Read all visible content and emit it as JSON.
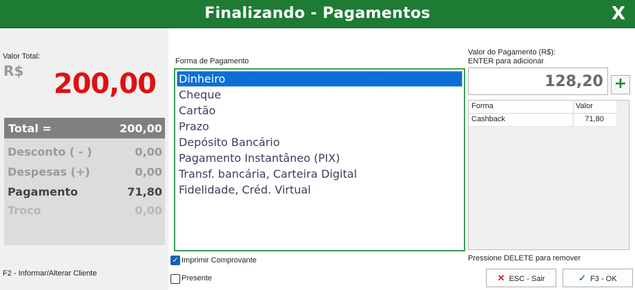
{
  "window": {
    "title": "Finalizando - Pagamentos",
    "close_label": "X"
  },
  "summary": {
    "valor_total_label": "Valor Total:",
    "currency": "R$",
    "valor_total": "200,00",
    "total_label": "Total =",
    "total_value": "200,00",
    "desconto_label": "Desconto ( - )",
    "desconto_value": "0,00",
    "despesas_label": "Despesas (+)",
    "despesas_value": "0,00",
    "pagamento_label": "Pagamento",
    "pagamento_value": "71,80",
    "troco_label": "Troco",
    "troco_value": "0,00"
  },
  "f2_hint": "F2 - Informar/Alterar Cliente",
  "forma": {
    "label": "Forma de Pagamento",
    "items": [
      "Dinheiro",
      "Cheque",
      "Cartão",
      "Prazo",
      "Depósito Bancário",
      "Pagamento Instantâneo (PIX)",
      "Transf. bancária, Carteira Digital",
      "Fidelidade, Créd. Virtual"
    ],
    "selected": "Dinheiro"
  },
  "options": {
    "imprimir_label": "Imprimir Comprovante",
    "imprimir_checked": true,
    "presente_label": "Presente",
    "presente_checked": false
  },
  "valor_pagamento": {
    "label_line1": "Valor do Pagamento (R$):",
    "label_line2": "ENTER para adicionar",
    "value": "128,20",
    "add_label": "+"
  },
  "payments_table": {
    "headers": [
      "Forma",
      "Valor"
    ],
    "rows": [
      {
        "forma": "Cashback",
        "valor": "71,80"
      }
    ]
  },
  "delete_hint": "Pressione DELETE para remover",
  "buttons": {
    "esc_icon": "✕",
    "esc_label": "ESC - Sair",
    "ok_icon": "✓",
    "ok_label": "F3 - OK"
  },
  "colors": {
    "title_bar": "#1e7b34",
    "accent_red": "#e01010",
    "selection_blue": "#0a6fd6",
    "list_border": "#3a9e5a"
  }
}
